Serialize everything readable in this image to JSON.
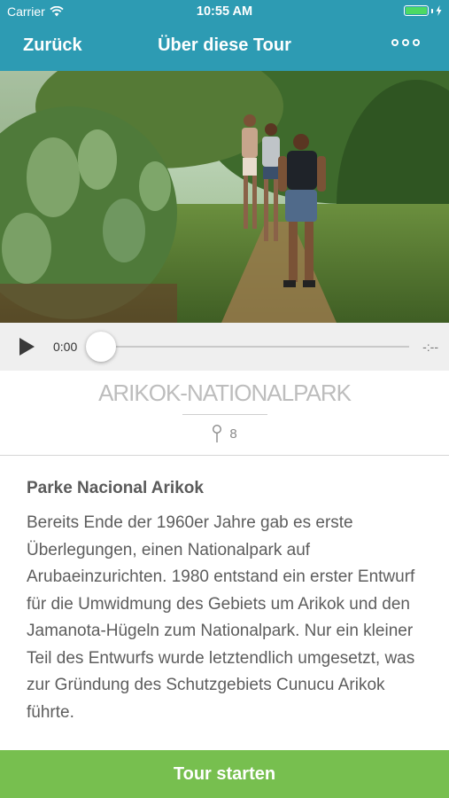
{
  "status_bar": {
    "carrier": "Carrier",
    "time": "10:55 AM"
  },
  "nav": {
    "back_label": "Zurück",
    "title": "Über diese Tour",
    "more_icon": "more-icon"
  },
  "hero": {
    "description": "hikers-on-trail-photo"
  },
  "player": {
    "current_time": "0:00",
    "remaining_time": "-:--",
    "progress": 0
  },
  "tour": {
    "name": "ARIKOK-NATIONALPARK",
    "stops_count": "8"
  },
  "article": {
    "heading": "Parke Nacional Arikok",
    "body": "Bereits Ende der 1960er Jahre gab es erste Überlegungen, einen Nationalpark auf Arubaeinzurichten. 1980 entstand ein erster Entwurf für die Umwidmung des Gebiets um Arikok und den Jamanota-Hügeln zum Nationalpark. Nur ein kleiner Teil des Entwurfs wurde letztendlich umgesetzt, was zur Gründung des Schutzgebiets Cunucu Arikok führte."
  },
  "footer": {
    "start_label": "Tour starten"
  },
  "colors": {
    "header": "#2d9bb3",
    "start_button": "#77bf4f",
    "battery": "#4cd964"
  }
}
